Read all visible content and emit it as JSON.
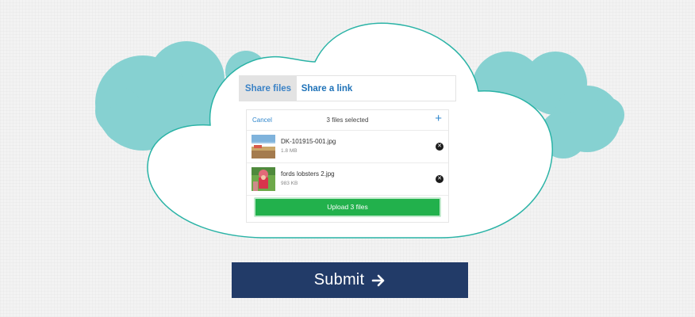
{
  "tabs": [
    {
      "label": "Share files"
    },
    {
      "label": "Share a link"
    }
  ],
  "panel": {
    "cancel_label": "Cancel",
    "selection_text": "3 files selected",
    "add_icon": "plus-icon"
  },
  "files": [
    {
      "name": "DK-101915-001.jpg",
      "size": "1.8 MB"
    },
    {
      "name": "fords lobsters 2.jpg",
      "size": "983 KB"
    }
  ],
  "upload_button_label": "Upload 3 files",
  "submit": {
    "label": "Submit",
    "icon": "arrow-right-icon"
  },
  "colors": {
    "cloud_teal": "#86d1d1",
    "cloud_outline": "#2ab3a6",
    "accent_blue": "#2f86cc",
    "upload_green": "#22b14c",
    "submit_navy": "#223b68"
  }
}
